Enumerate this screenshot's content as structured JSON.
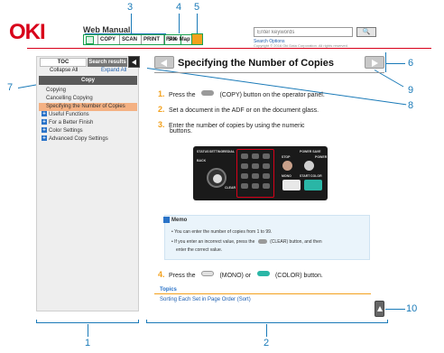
{
  "header": {
    "logo": "OKI",
    "web_manual": "Web Manual",
    "nav": [
      "COPY",
      "SCAN",
      "PRINT",
      "FAX"
    ],
    "site_map": "Site Map",
    "search_placeholder": "Enter keywords",
    "search_button": "🔍",
    "search_options": "Search Options",
    "copyright": "Copyright © 2016 Oki Data Corporation. All rights reserved."
  },
  "sidebar": {
    "tab_toc": "TOC",
    "tab_search": "Search results",
    "collapse_all": "Collapse All",
    "expand_all": "Expand All",
    "section": "Copy",
    "items": [
      {
        "label": "Copying",
        "type": "item"
      },
      {
        "label": "Cancelling Copying",
        "type": "item"
      },
      {
        "label": "Specifying the Number of Copies",
        "type": "active"
      },
      {
        "label": "Useful Functions",
        "type": "folder"
      },
      {
        "label": "For a Better Finish",
        "type": "folder"
      },
      {
        "label": "Color Settings",
        "type": "folder"
      },
      {
        "label": "Advanced Copy Settings",
        "type": "folder"
      }
    ]
  },
  "main": {
    "title": "Specifying the Number of Copies",
    "steps": [
      {
        "num": "1.",
        "text_a": "Press the",
        "text_b": "(COPY) button on the operator panel."
      },
      {
        "num": "2.",
        "text": "Set a document in the ADF or on the document glass."
      },
      {
        "num": "3.",
        "text": "Enter the number of copies by using the numeric",
        "text2": "buttons."
      },
      {
        "num": "4.",
        "text_a": "Press the",
        "text_b": "(MONO) or",
        "text_c": "(COLOR) button."
      }
    ],
    "panel_labels": {
      "status": "STATUS",
      "setting": "SETTING",
      "redial": "REDIAL",
      "back": "BACK",
      "ok": "OK",
      "stop": "STOP",
      "power_save": "POWER SAVE",
      "power": "POWER",
      "mono": "MONO",
      "start": "START",
      "color": "COLOR",
      "clear": "CLEAR"
    },
    "memo": {
      "title": "Memo",
      "lines": [
        "You can enter the number of copies from 1 to 99.",
        "If you enter an incorrect value, press the",
        "(CLEAR) button, and then",
        "enter the correct value."
      ]
    },
    "topics": {
      "label": "Topics",
      "link": "Sorting Each Set in Page Order (Sort)"
    }
  },
  "callouts": [
    "1",
    "2",
    "3",
    "4",
    "5",
    "6",
    "7",
    "8",
    "9",
    "10"
  ],
  "colors": {
    "brand_red": "#d8001a",
    "accent_green": "#1aa14f",
    "callout_blue": "#1a7ab8",
    "step_orange": "#f3a11d"
  }
}
